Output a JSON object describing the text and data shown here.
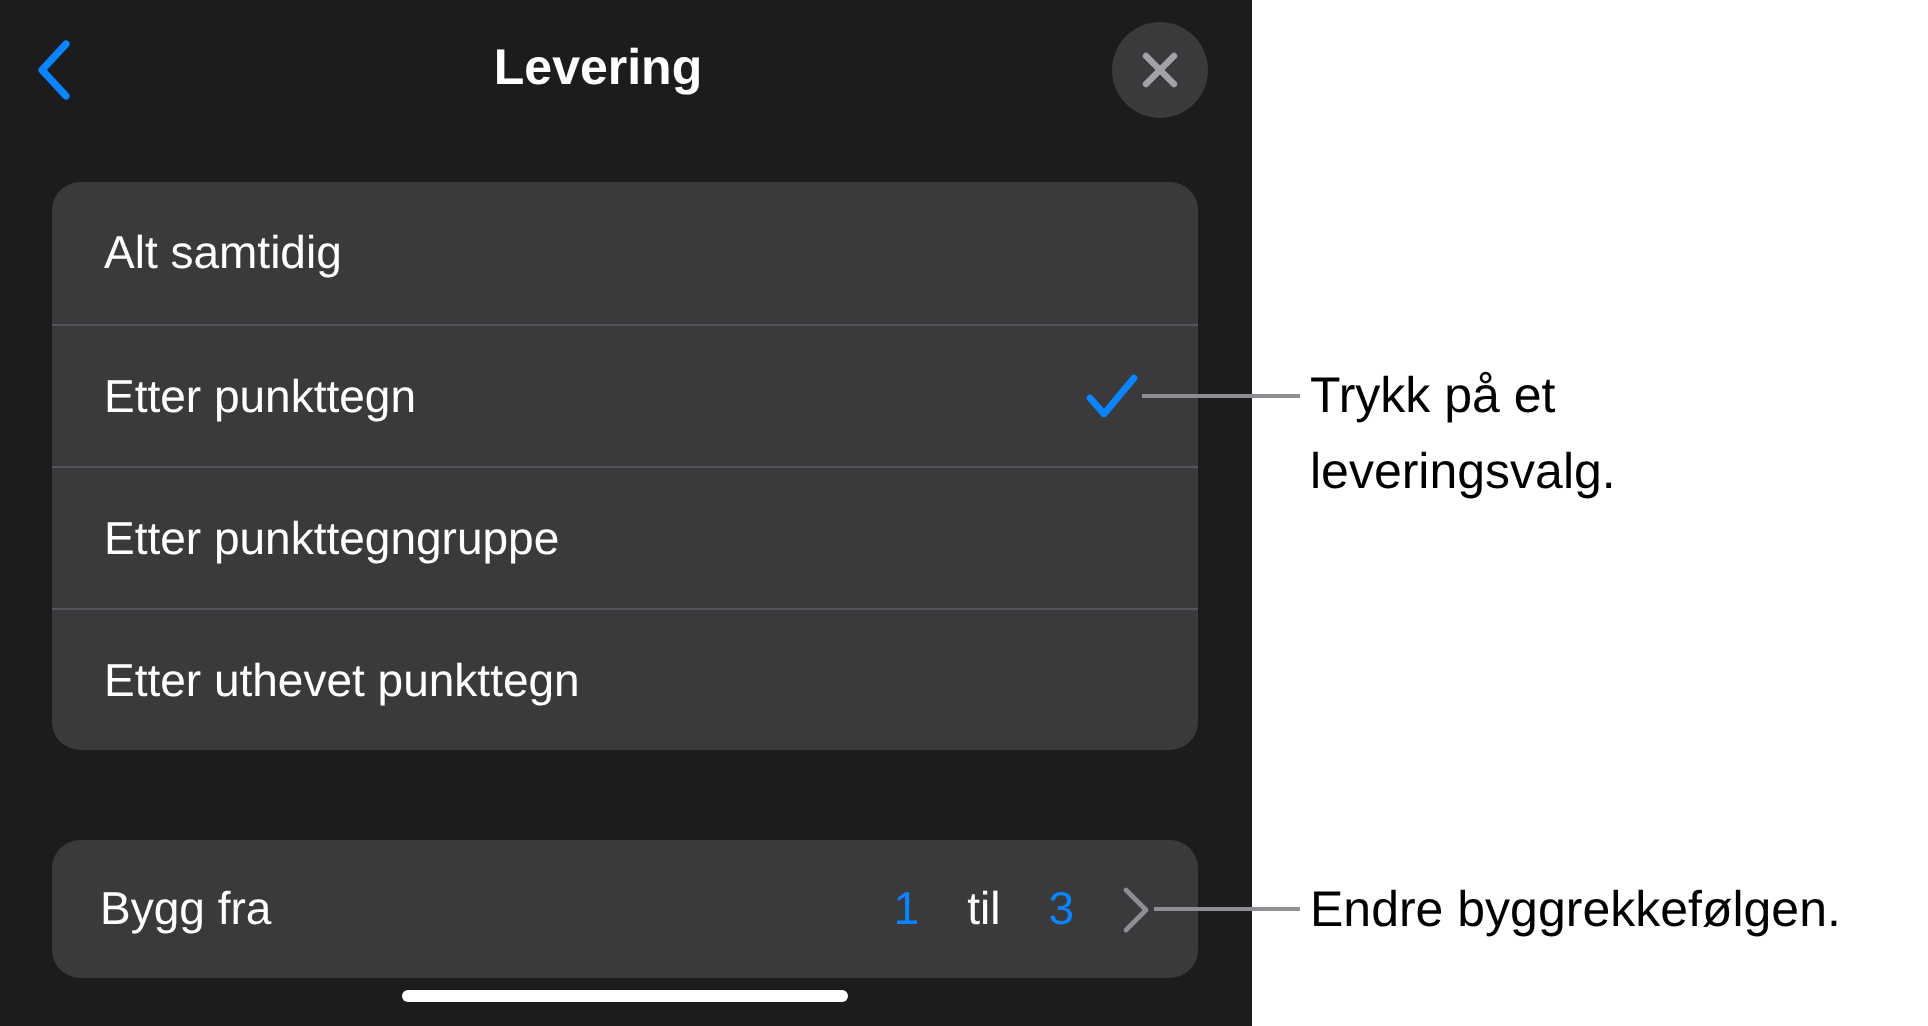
{
  "header": {
    "title": "Levering"
  },
  "options": [
    {
      "label": "Alt samtidig",
      "selected": false
    },
    {
      "label": "Etter punkttegn",
      "selected": true
    },
    {
      "label": "Etter punkttegngruppe",
      "selected": false
    },
    {
      "label": "Etter uthevet punkttegn",
      "selected": false
    }
  ],
  "build": {
    "label": "Bygg fra",
    "from": "1",
    "joiner": "til",
    "to": "3"
  },
  "callouts": [
    {
      "text": "Trykk på et leveringsvalg.",
      "kind": "option"
    },
    {
      "text": "Endre byggrekkefølgen.",
      "kind": "build"
    }
  ]
}
